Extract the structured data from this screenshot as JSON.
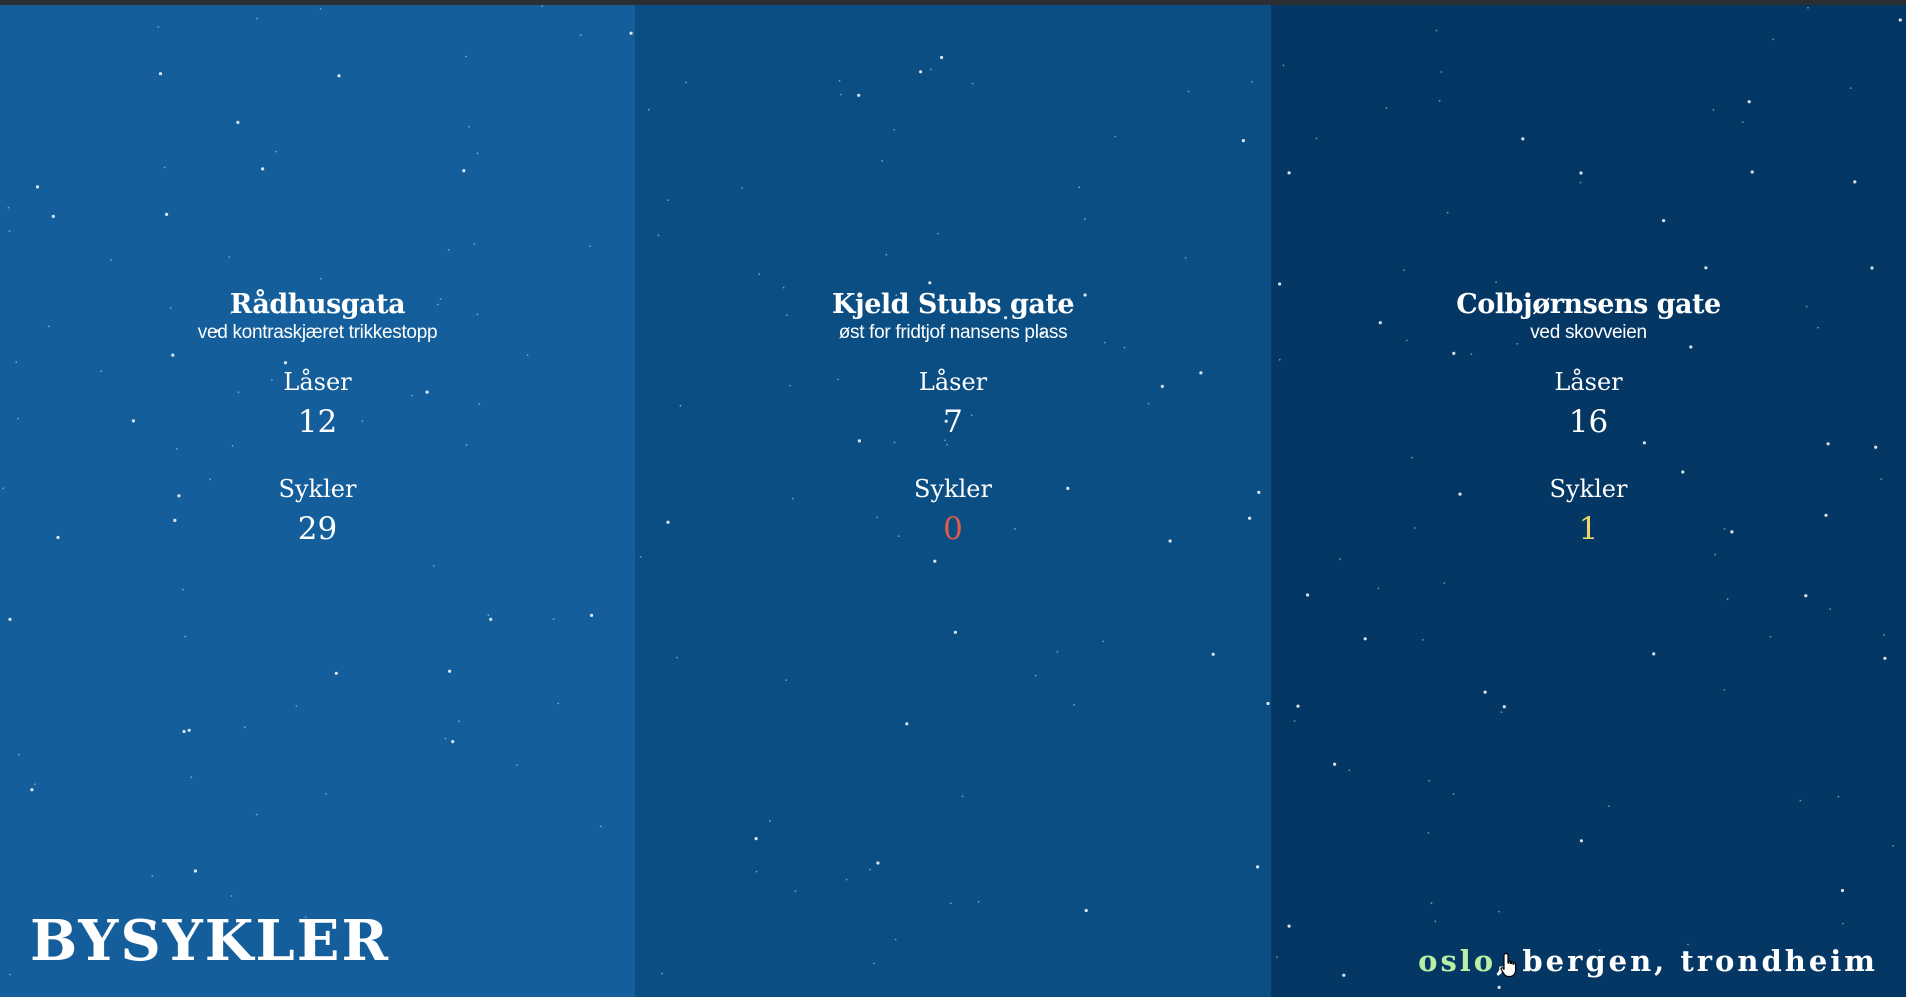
{
  "colors": {
    "panel_1": "#135e9b",
    "panel_2": "#0b4e84",
    "panel_3": "#043764",
    "text": "#ffffff",
    "empty": "#e35a4a",
    "low": "#e8d66b",
    "active_city": "#b9f0a6"
  },
  "stations": [
    {
      "name": "Rådhusgata",
      "description": "ved kontraskjæret trikkestopp",
      "locks_label": "Låser",
      "locks": "12",
      "bikes_label": "Sykler",
      "bikes": "29",
      "bikes_status": "normal"
    },
    {
      "name": "Kjeld Stubs gate",
      "description": "øst for fridtjof nansens plass",
      "locks_label": "Låser",
      "locks": "7",
      "bikes_label": "Sykler",
      "bikes": "0",
      "bikes_status": "empty"
    },
    {
      "name": "Colbjørnsens gate",
      "description": "ved skovveien",
      "locks_label": "Låser",
      "locks": "16",
      "bikes_label": "Sykler",
      "bikes": "1",
      "bikes_status": "low"
    }
  ],
  "logo": "BYSYKLER",
  "cities": {
    "items": [
      "oslo",
      "bergen",
      "trondheim"
    ],
    "separator": ", ",
    "active": "oslo"
  },
  "icons": {
    "cursor": "hand-pointer-icon"
  }
}
